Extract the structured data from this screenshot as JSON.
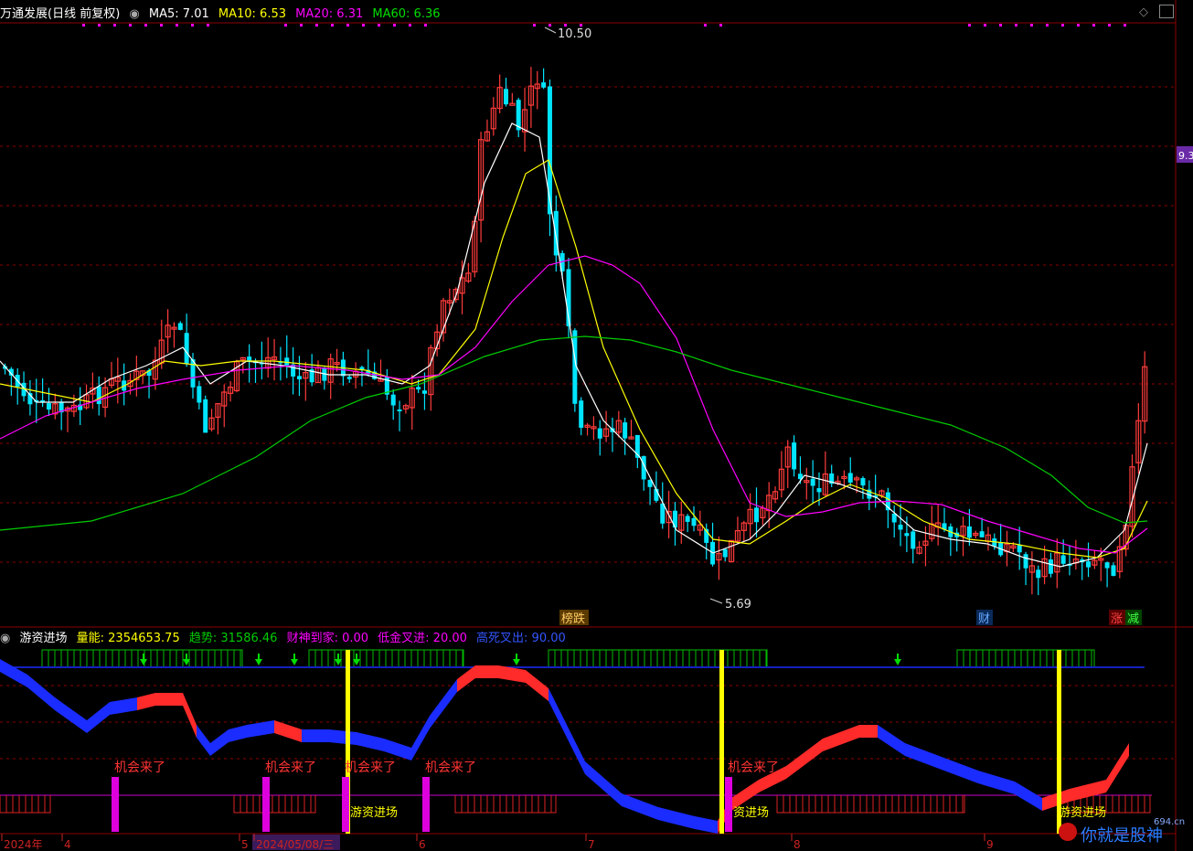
{
  "window": {
    "stock_name": "万通发展(日线 前复权)",
    "ma5_label": "MA5: 7.01",
    "ma10_label": "MA10: 6.53",
    "ma20_label": "MA20: 6.31",
    "ma60_label": "MA60: 6.36",
    "price_tag": "9.3",
    "high_label": "10.50",
    "low_label": "5.69",
    "event_labels": [
      "榜跌",
      "财",
      "涨",
      "减"
    ]
  },
  "indicator": {
    "name": "游资进场",
    "liangneng": "量能: 2354653.75",
    "qushi": "趋势: 31586.46",
    "caishen": "财神到家: 0.00",
    "dijin": "低金叉进: 20.00",
    "gaosi": "高死叉出: 90.00",
    "signal_text": "机会来了",
    "enter_text": "游资进场",
    "enter_text_short": "资进场"
  },
  "xaxis": {
    "labels": [
      "2024年",
      "4",
      "5",
      "2024/05/08/三",
      "6",
      "7",
      "8",
      "9"
    ]
  },
  "watermark": {
    "text": "你就是股神",
    "url": "694.cn"
  },
  "colors": {
    "up": "#ff3b3b",
    "down": "#00e5ff",
    "ma5": "#ffffff",
    "ma10": "#ffff00",
    "ma20": "#ff00ff",
    "ma60": "#00cc00",
    "grid": "#8b0000",
    "band_red": "#ff2a2a",
    "band_blue": "#1a2cff",
    "signal_yellow": "#ffff00",
    "signal_magenta": "#dd00dd"
  },
  "chart_data": {
    "type": "candlestick",
    "price_high": 10.5,
    "price_low": 5.69,
    "moving_averages": {
      "MA5": 7.01,
      "MA10": 6.53,
      "MA20": 6.31,
      "MA60": 6.36
    },
    "indicator_values": {
      "量能": 2354653.75,
      "趋势": 31586.46,
      "财神到家": 0.0,
      "低金叉进": 20.0,
      "高死叉出": 90.0
    }
  }
}
